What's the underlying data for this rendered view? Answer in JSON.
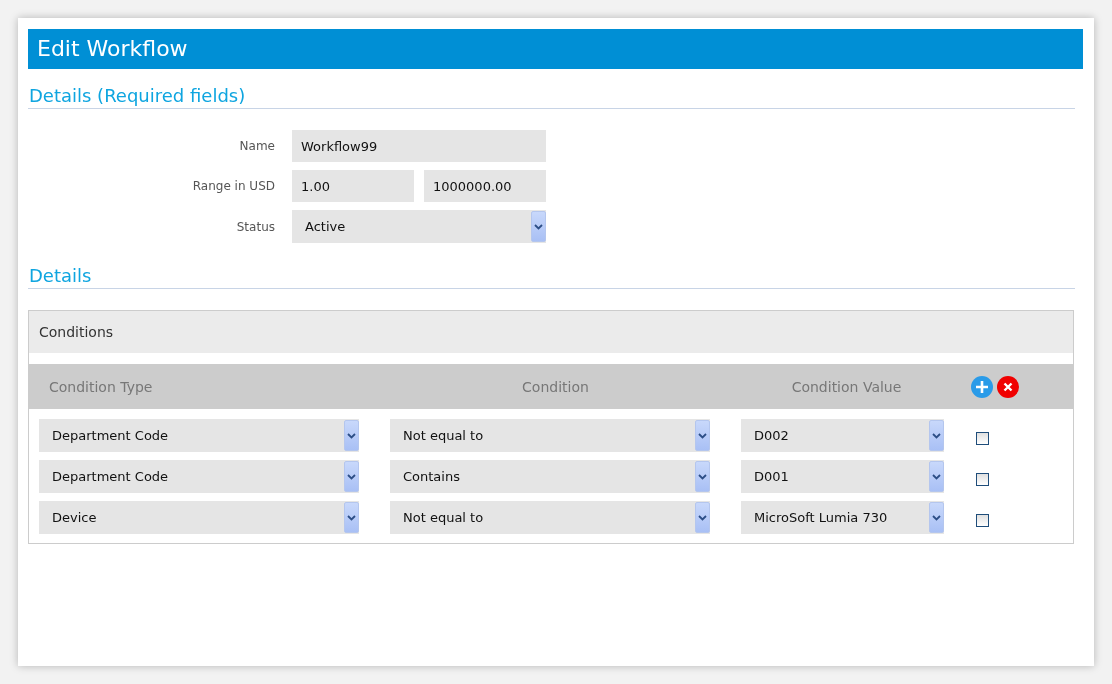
{
  "title": "Edit Workflow",
  "required_section": {
    "heading": "Details (Required fields)",
    "fields": [
      {
        "label": "Name",
        "kind": "text",
        "values": [
          "Workflow99"
        ]
      },
      {
        "label": "Range in USD",
        "kind": "range",
        "values": [
          "1.00",
          "1000000.00"
        ]
      },
      {
        "label": "Status",
        "kind": "select",
        "values": [
          "Active"
        ]
      }
    ]
  },
  "details_section": {
    "heading": "Details"
  },
  "conditions": {
    "title": "Conditions",
    "columns": [
      "Condition Type",
      "Condition",
      "Condition Value"
    ],
    "rows": [
      {
        "type": "Department Code",
        "condition": "Not equal to",
        "value": "D002",
        "checked": false
      },
      {
        "type": "Department Code",
        "condition": "Contains",
        "value": "D001",
        "checked": false
      },
      {
        "type": "Device",
        "condition": "Not equal to",
        "value": "MicroSoft Lumia 730",
        "checked": false
      }
    ]
  }
}
